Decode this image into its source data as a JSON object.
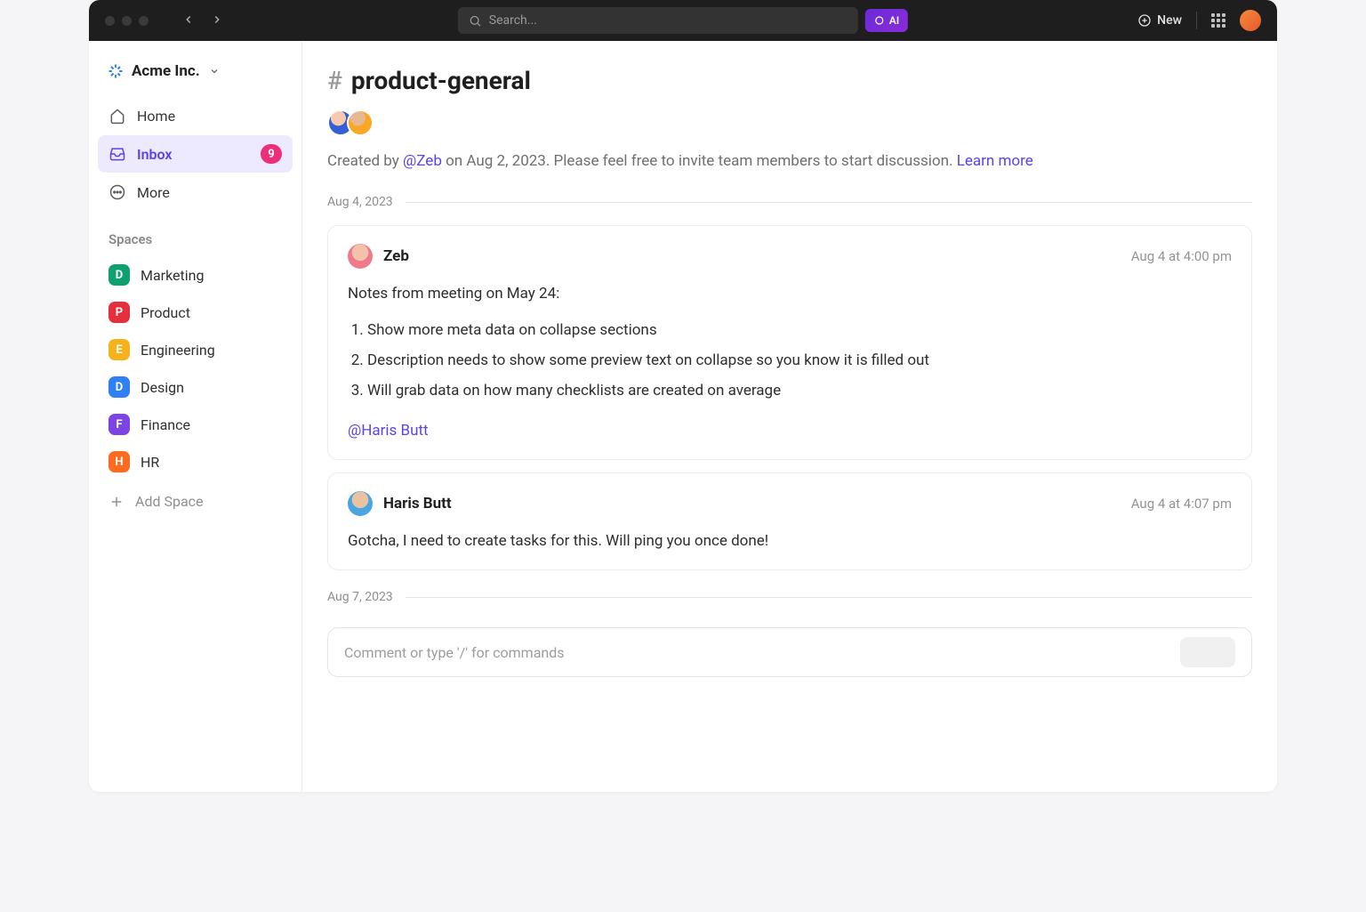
{
  "titlebar": {
    "search_placeholder": "Search...",
    "ai_label": "AI",
    "new_label": "New"
  },
  "workspace": {
    "name": "Acme Inc."
  },
  "nav": {
    "home": "Home",
    "inbox": "Inbox",
    "inbox_badge": "9",
    "more": "More"
  },
  "spaces_label": "Spaces",
  "spaces": [
    {
      "letter": "D",
      "name": "Marketing",
      "color": "#0fa070"
    },
    {
      "letter": "P",
      "name": "Product",
      "color": "#e52f3c"
    },
    {
      "letter": "E",
      "name": "Engineering",
      "color": "#f5b21a"
    },
    {
      "letter": "D",
      "name": "Design",
      "color": "#2f7ff5"
    },
    {
      "letter": "F",
      "name": "Finance",
      "color": "#7b44e3"
    },
    {
      "letter": "H",
      "name": "HR",
      "color": "#ff6a1f"
    }
  ],
  "add_space": "Add Space",
  "channel": {
    "name": "product-general",
    "created_prefix": "Created by ",
    "created_by": "@Zeb",
    "created_rest": " on Aug 2, 2023. Please feel free to invite team members to start discussion. ",
    "learn_more": "Learn more"
  },
  "dates": {
    "d1": "Aug 4, 2023",
    "d2": "Aug 7, 2023"
  },
  "messages": [
    {
      "author": "Zeb",
      "time": "Aug 4 at 4:00 pm",
      "intro": "Notes from meeting on May 24:",
      "items": [
        "Show more meta data on collapse sections",
        "Description needs to show some preview text on collapse so you know it is filled out",
        "Will grab data on how many checklists are created on average"
      ],
      "mention": "@Haris Butt"
    },
    {
      "author": "Haris Butt",
      "time": "Aug 4 at 4:07 pm",
      "body": "Gotcha, I need to create tasks for this. Will ping you once done!"
    }
  ],
  "composer_placeholder": "Comment or type '/' for commands"
}
